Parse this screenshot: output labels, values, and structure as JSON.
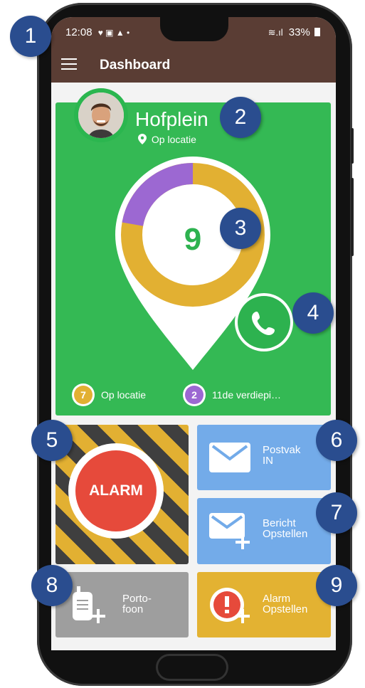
{
  "statusbar": {
    "time": "12:08",
    "battery": "33%",
    "left_icons": "♥ ▣ ▲ •",
    "signal": "≋.ıl"
  },
  "appbar": {
    "title": "Dashboard"
  },
  "location": {
    "name": "Hofplein",
    "status": "Op locatie"
  },
  "donut": {
    "count": "9",
    "segments": [
      {
        "label": "Op locatie",
        "value": 7,
        "color": "#e2b032"
      },
      {
        "label": "11de verdiepi…",
        "value": 2,
        "color": "#9c68d2"
      }
    ]
  },
  "legend": [
    {
      "count": "7",
      "label": "Op locatie",
      "color": "#e2b032"
    },
    {
      "count": "2",
      "label": "11de verdiepi…",
      "color": "#9c68d2"
    }
  ],
  "tiles": {
    "alarm": "ALARM",
    "inbox_line1": "Postvak",
    "inbox_line2": "IN",
    "compose_line1": "Bericht",
    "compose_line2": "Opstellen",
    "walkie_line1": "Porto-",
    "walkie_line2": "foon",
    "alarm_compose_line1": "Alarm",
    "alarm_compose_line2": "Opstellen"
  },
  "badges": [
    "1",
    "2",
    "3",
    "4",
    "5",
    "6",
    "7",
    "8",
    "9"
  ],
  "colors": {
    "brand": "#5a3d34",
    "green": "#34b954",
    "blue": "#73abe9",
    "alarm_red": "#e64a3b",
    "orange": "#e3b232",
    "gray": "#9e9e9e",
    "badge": "#2a4d8f"
  }
}
